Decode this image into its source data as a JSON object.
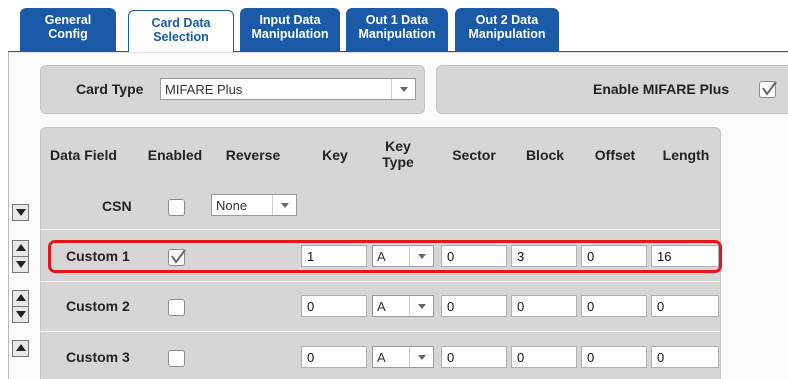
{
  "tabs": [
    {
      "line1": "General",
      "line2": "Config"
    },
    {
      "line1": "Card Data",
      "line2": "Selection"
    },
    {
      "line1": "Input Data",
      "line2": "Manipulation"
    },
    {
      "line1": "Out 1 Data",
      "line2": "Manipulation"
    },
    {
      "line1": "Out 2 Data",
      "line2": "Manipulation"
    }
  ],
  "card_type": {
    "label": "Card Type",
    "value": "MIFARE Plus"
  },
  "enable_mifare_plus": {
    "label": "Enable MIFARE Plus",
    "checked": true
  },
  "table": {
    "headers": {
      "data_field": "Data Field",
      "enabled": "Enabled",
      "reverse": "Reverse",
      "key": "Key",
      "key_type_1": "Key",
      "key_type_2": "Type",
      "sector": "Sector",
      "block": "Block",
      "offset": "Offset",
      "length": "Length"
    },
    "csn": {
      "name": "CSN",
      "enabled": false,
      "reverse": "None"
    },
    "rows": [
      {
        "name": "Custom 1",
        "enabled": true,
        "key": "1",
        "key_type": "A",
        "sector": "0",
        "block": "3",
        "offset": "0",
        "length": "16"
      },
      {
        "name": "Custom 2",
        "enabled": false,
        "key": "0",
        "key_type": "A",
        "sector": "0",
        "block": "0",
        "offset": "0",
        "length": "0"
      },
      {
        "name": "Custom 3",
        "enabled": false,
        "key": "0",
        "key_type": "A",
        "sector": "0",
        "block": "0",
        "offset": "0",
        "length": "0"
      }
    ]
  },
  "colors": {
    "tab": "#1a5aa6",
    "highlight": "#e8141b",
    "box": "#d6d6d6"
  }
}
